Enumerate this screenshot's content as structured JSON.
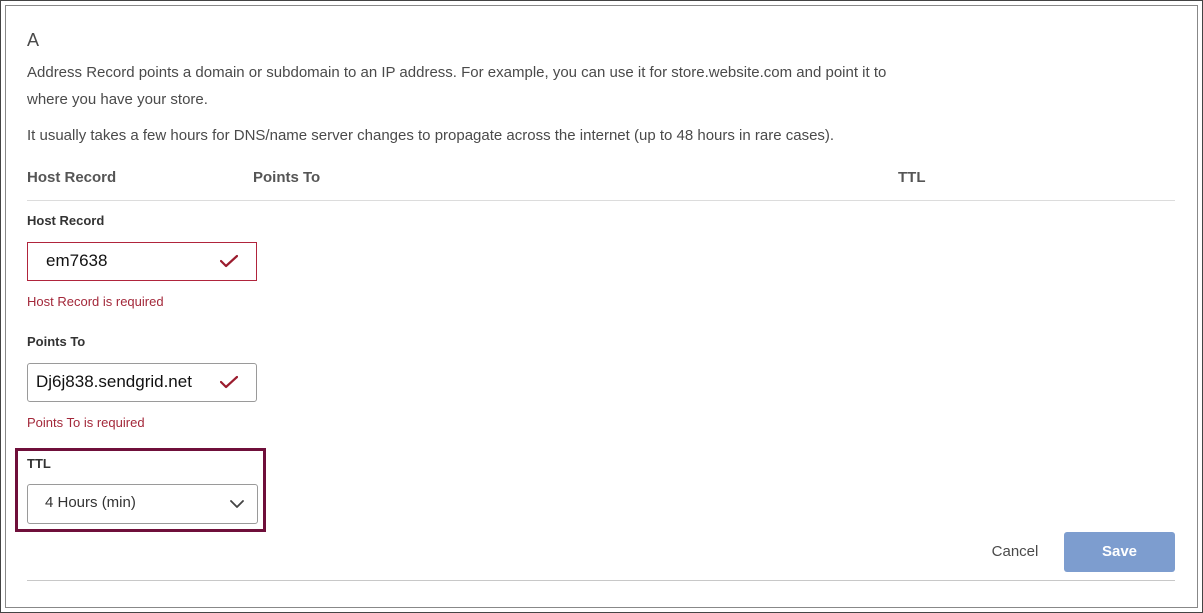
{
  "record": {
    "type": "A",
    "description": "Address Record points a domain or subdomain to an IP address. For example, you can use it for store.website.com and point it to where you have your store.",
    "propagation_note": "It usually takes a few hours for DNS/name server changes to propagate across the internet (up to 48 hours in rare cases)."
  },
  "columns": {
    "host_record": "Host Record",
    "points_to": "Points To",
    "ttl": "TTL"
  },
  "form": {
    "host_record": {
      "label": "Host Record",
      "value": "em7638",
      "error": "Host Record is required"
    },
    "points_to": {
      "label": "Points To",
      "value": "Dj6j838.sendgrid.net",
      "error": "Points To is required"
    },
    "ttl": {
      "label": "TTL",
      "selected": "4 Hours (min)"
    }
  },
  "actions": {
    "cancel": "Cancel",
    "save": "Save"
  },
  "colors": {
    "error": "#a3283a",
    "highlight": "#6f0f3a",
    "save_button": "#7d9dcf",
    "check": "#9b1c2e"
  },
  "icons": {
    "valid": "checkmark-icon",
    "dropdown": "chevron-down-icon"
  }
}
